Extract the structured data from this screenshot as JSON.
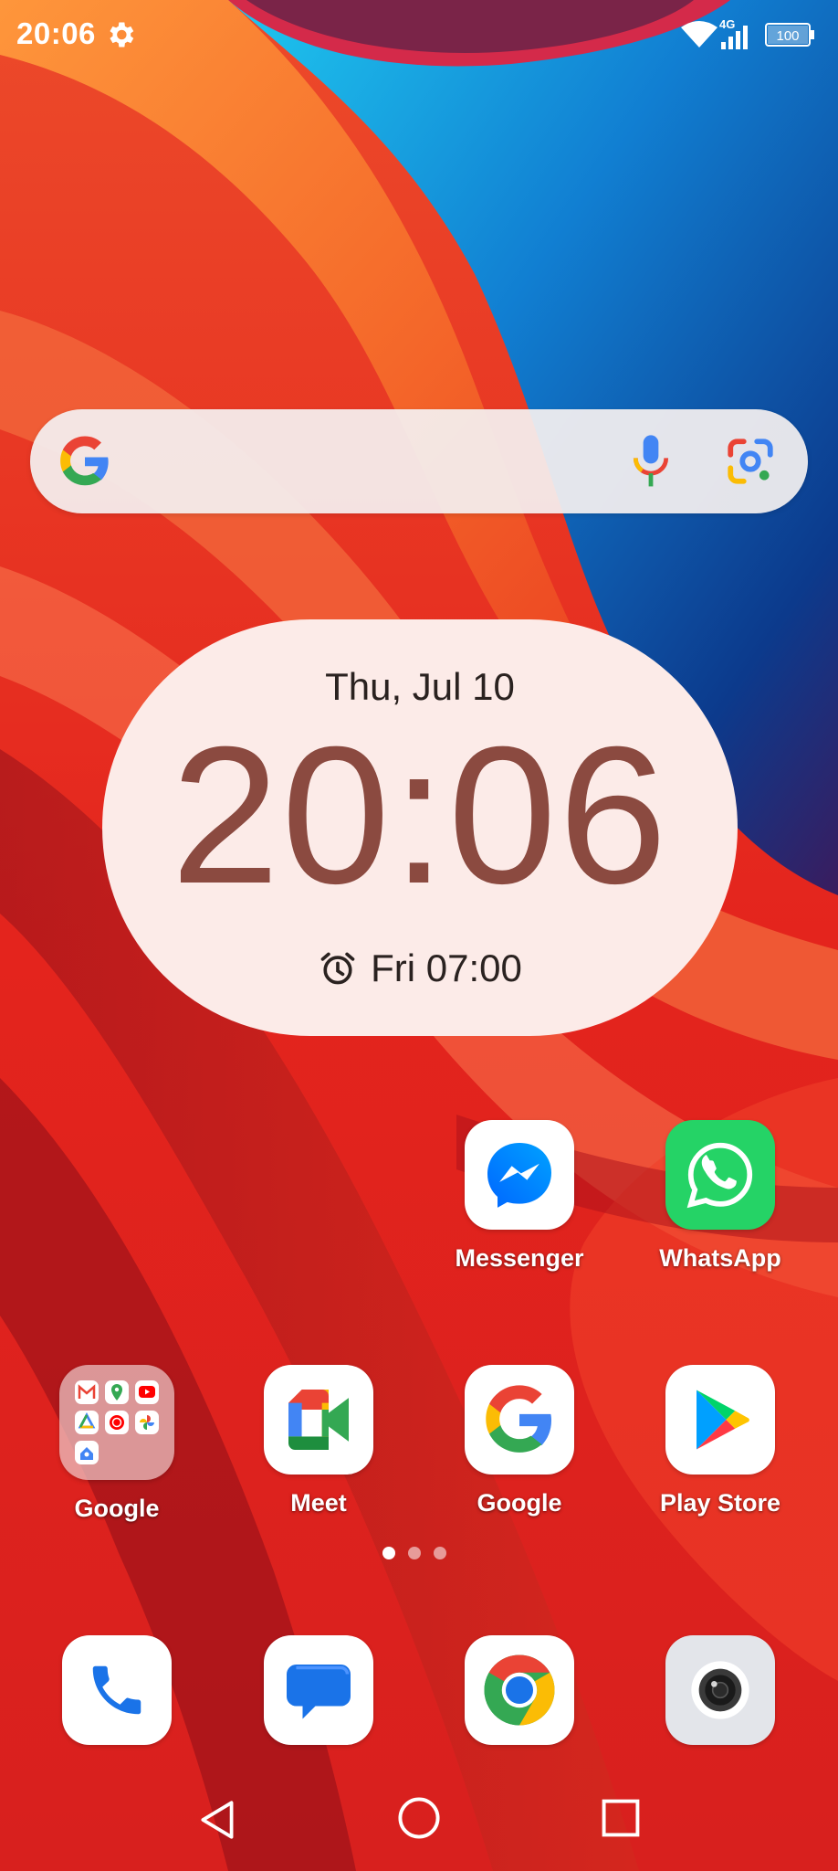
{
  "status_bar": {
    "time": "20:06",
    "network_type": "4G",
    "battery": "100",
    "icons": [
      "settings-gear-icon",
      "wifi-icon",
      "cellular-signal-icon",
      "battery-icon"
    ]
  },
  "search_widget": {
    "icons": [
      "google-g-icon",
      "microphone-icon",
      "google-lens-icon"
    ]
  },
  "clock_widget": {
    "date": "Thu, Jul 10",
    "time": "20:06",
    "alarm": "Fri 07:00",
    "colors": {
      "time_text": "#8b4a40",
      "background": "#fcebe8"
    }
  },
  "apps": {
    "row1": [
      {
        "label": "Messenger",
        "icon": "messenger-icon"
      },
      {
        "label": "WhatsApp",
        "icon": "whatsapp-icon"
      }
    ],
    "row2": [
      {
        "label": "Google",
        "icon": "google-folder-icon"
      },
      {
        "label": "Meet",
        "icon": "meet-icon"
      },
      {
        "label": "Google",
        "icon": "google-app-icon"
      },
      {
        "label": "Play Store",
        "icon": "play-store-icon"
      }
    ]
  },
  "dock": [
    "phone-icon",
    "messages-icon",
    "chrome-icon",
    "camera-icon"
  ],
  "page_indicator": {
    "pages": 3,
    "current": 1
  },
  "nav_bar": [
    "back-icon",
    "home-icon",
    "recents-icon"
  ]
}
